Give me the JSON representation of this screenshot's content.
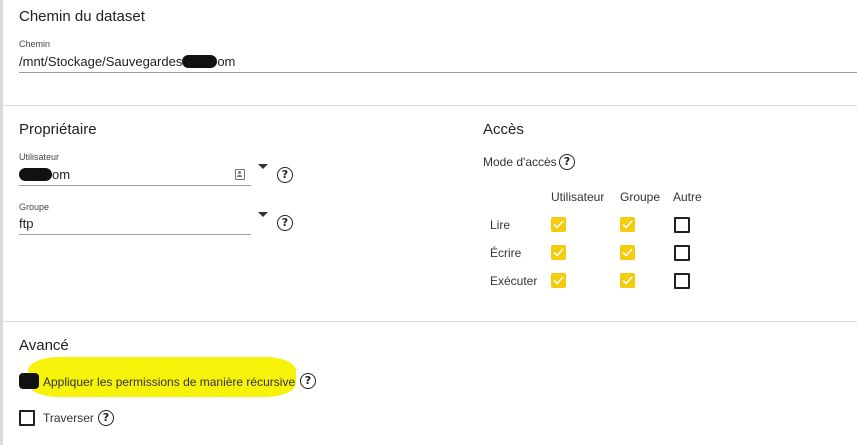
{
  "dataset_path": {
    "title": "Chemin du dataset",
    "label": "Chemin",
    "value_prefix": "/mnt/Stockage/Sauvegardes",
    "value_suffix": "om"
  },
  "owner": {
    "title": "Propriétaire",
    "user_label": "Utilisateur",
    "user_value_suffix": "om",
    "group_label": "Groupe",
    "group_value": "ftp"
  },
  "access": {
    "title": "Accès",
    "mode_label": "Mode d'accès",
    "columns": [
      "Utilisateur",
      "Groupe",
      "Autre"
    ],
    "rows": [
      {
        "label": "Lire",
        "checked": [
          true,
          true,
          false
        ]
      },
      {
        "label": "Écrire",
        "checked": [
          true,
          true,
          false
        ]
      },
      {
        "label": "Exécuter",
        "checked": [
          true,
          true,
          false
        ]
      }
    ],
    "check_color": "#f5cc0b"
  },
  "advanced": {
    "title": "Avancé",
    "recursive_label": "Appliquer les permissions de manière récursive",
    "traverse_label": "Traverser"
  },
  "icons": {
    "help": "help-circle-icon",
    "dropdown": "caret-down-icon",
    "user_picker": "person-icon",
    "check": "check-icon"
  },
  "colors": {
    "highlight": "#f7f20a",
    "checkbox_checked": "#f5cc0b"
  }
}
